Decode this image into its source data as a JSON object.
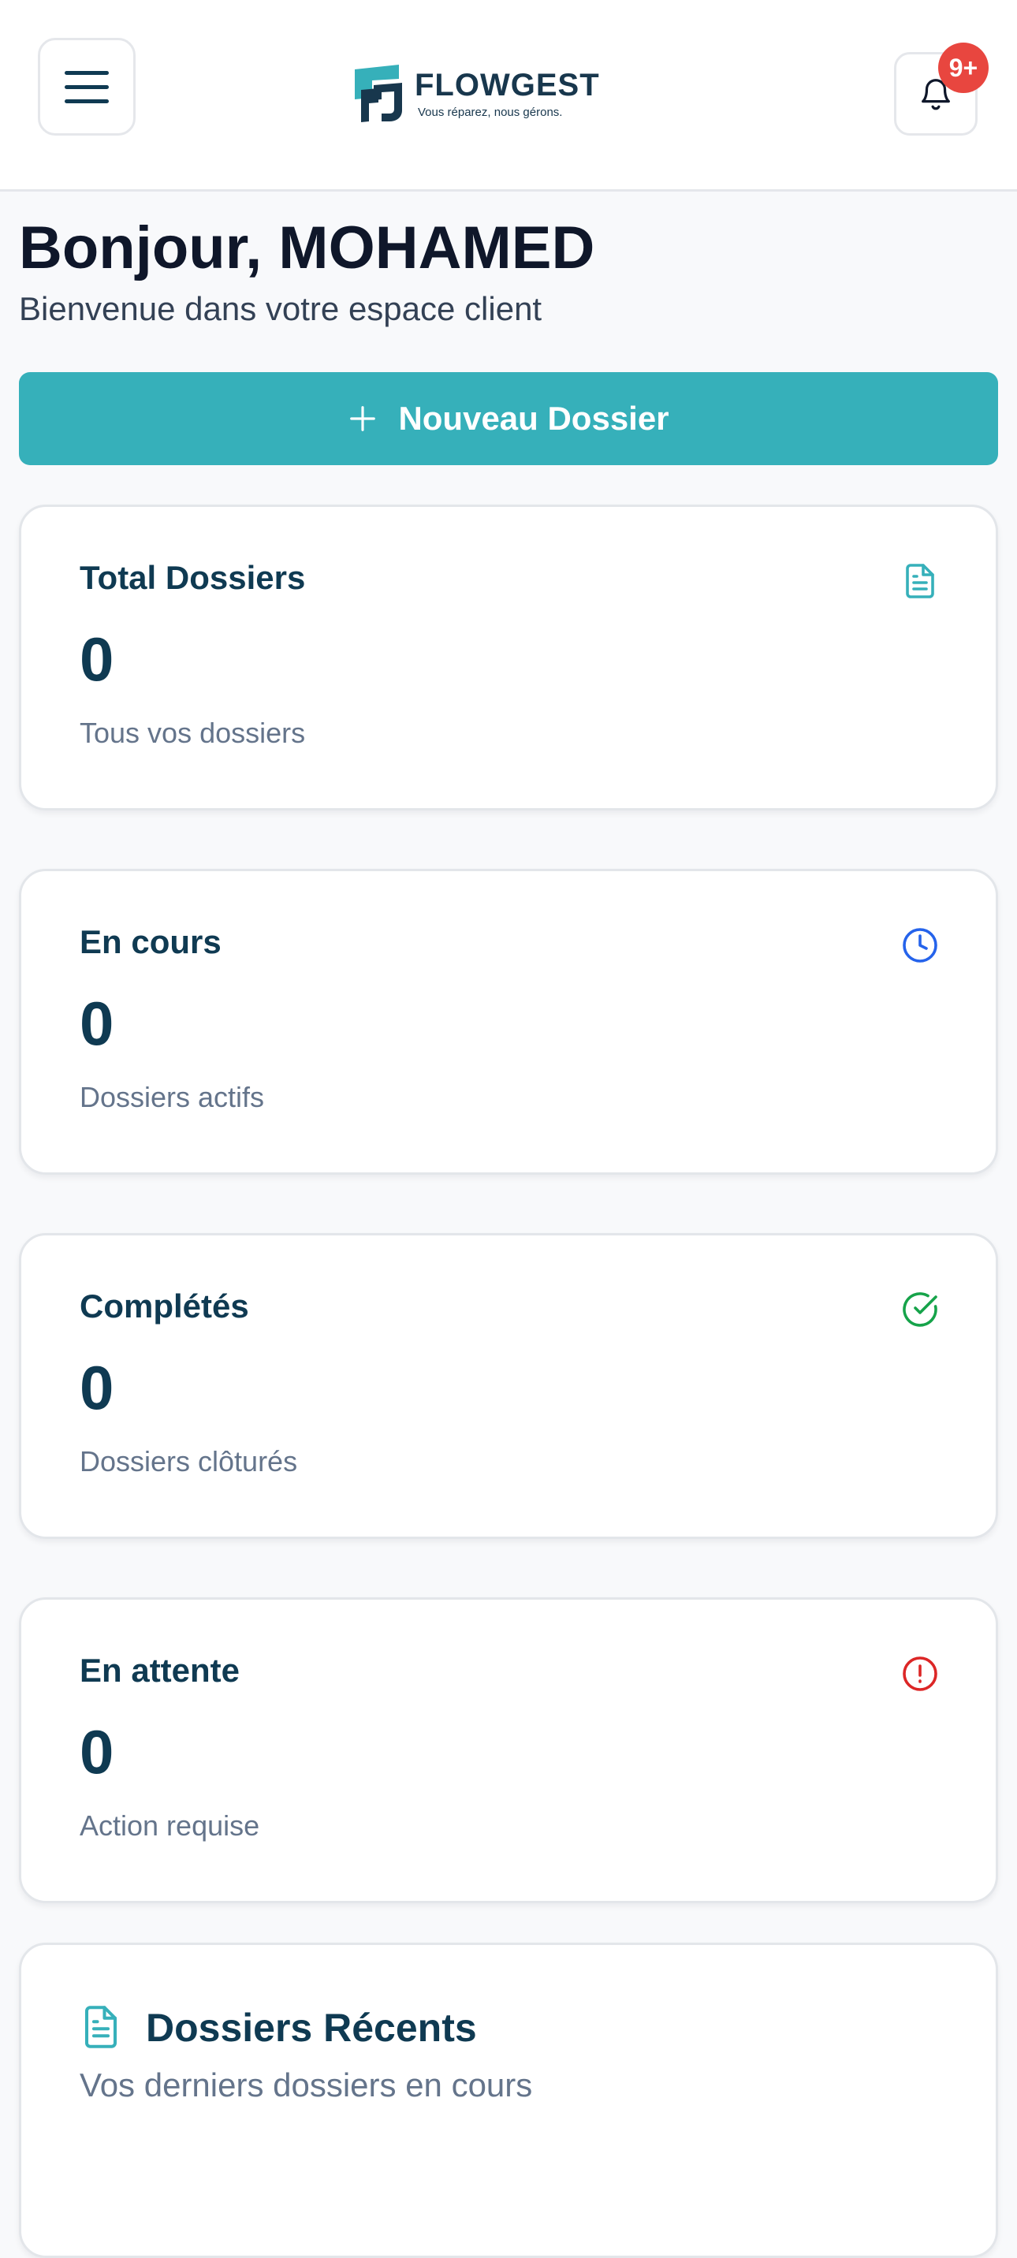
{
  "header": {
    "brand_name": "FLOWGEST",
    "brand_tagline": "Vous réparez, nous gérons.",
    "notification_badge": "9+"
  },
  "greeting": {
    "title": "Bonjour, MOHAMED",
    "subtitle": "Bienvenue dans votre espace client"
  },
  "new_dossier_button": {
    "icon": "plus-icon",
    "label": "Nouveau Dossier"
  },
  "stats": [
    {
      "title": "Total Dossiers",
      "value": "0",
      "description": "Tous vos dossiers",
      "icon": "document-icon",
      "color": "#36b0ba"
    },
    {
      "title": "En cours",
      "value": "0",
      "description": "Dossiers actifs",
      "icon": "clock-icon",
      "color": "#2563eb"
    },
    {
      "title": "Complétés",
      "value": "0",
      "description": "Dossiers clôturés",
      "icon": "check-circle-icon",
      "color": "#16a34a"
    },
    {
      "title": "En attente",
      "value": "0",
      "description": "Action requise",
      "icon": "alert-circle-icon",
      "color": "#dc2626"
    }
  ],
  "recent": {
    "title": "Dossiers Récents",
    "subtitle": "Vos derniers dossiers en cours",
    "icon": "document-icon"
  },
  "colors": {
    "accent": "#36b0ba",
    "heading": "#0f3a52",
    "badge": "#e8463f",
    "background": "#f8f9fb"
  }
}
